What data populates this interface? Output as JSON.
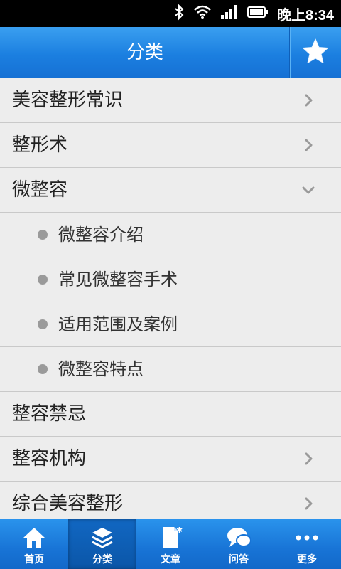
{
  "status_bar": {
    "time": "晚上8:34"
  },
  "header": {
    "title": "分类",
    "favorite_icon": "star-icon"
  },
  "list": [
    {
      "label": "美容整形常识",
      "type": "category",
      "indicator": "chevron-right"
    },
    {
      "label": "整形术",
      "type": "category",
      "indicator": "chevron-right"
    },
    {
      "label": "微整容",
      "type": "category",
      "indicator": "chevron-down"
    },
    {
      "label": "微整容介绍",
      "type": "subitem",
      "indicator": "bullet"
    },
    {
      "label": "常见微整容手术",
      "type": "subitem",
      "indicator": "bullet"
    },
    {
      "label": "适用范围及案例",
      "type": "subitem",
      "indicator": "bullet"
    },
    {
      "label": "微整容特点",
      "type": "subitem",
      "indicator": "bullet"
    },
    {
      "label": "整容禁忌",
      "type": "category",
      "indicator": "none"
    },
    {
      "label": "整容机构",
      "type": "category",
      "indicator": "chevron-right"
    },
    {
      "label": "综合美容整形",
      "type": "category",
      "indicator": "chevron-right"
    }
  ],
  "bottom_nav": [
    {
      "label": "首页",
      "icon": "home-icon",
      "active": false
    },
    {
      "label": "分类",
      "icon": "layers-icon",
      "active": true
    },
    {
      "label": "文章",
      "icon": "document-icon",
      "active": false
    },
    {
      "label": "问答",
      "icon": "chat-icon",
      "active": false
    },
    {
      "label": "更多",
      "icon": "more-icon",
      "active": false
    }
  ],
  "colors": {
    "primary": "#1b7fe0",
    "list_background": "#ededed",
    "divider": "#c9c9c9"
  }
}
